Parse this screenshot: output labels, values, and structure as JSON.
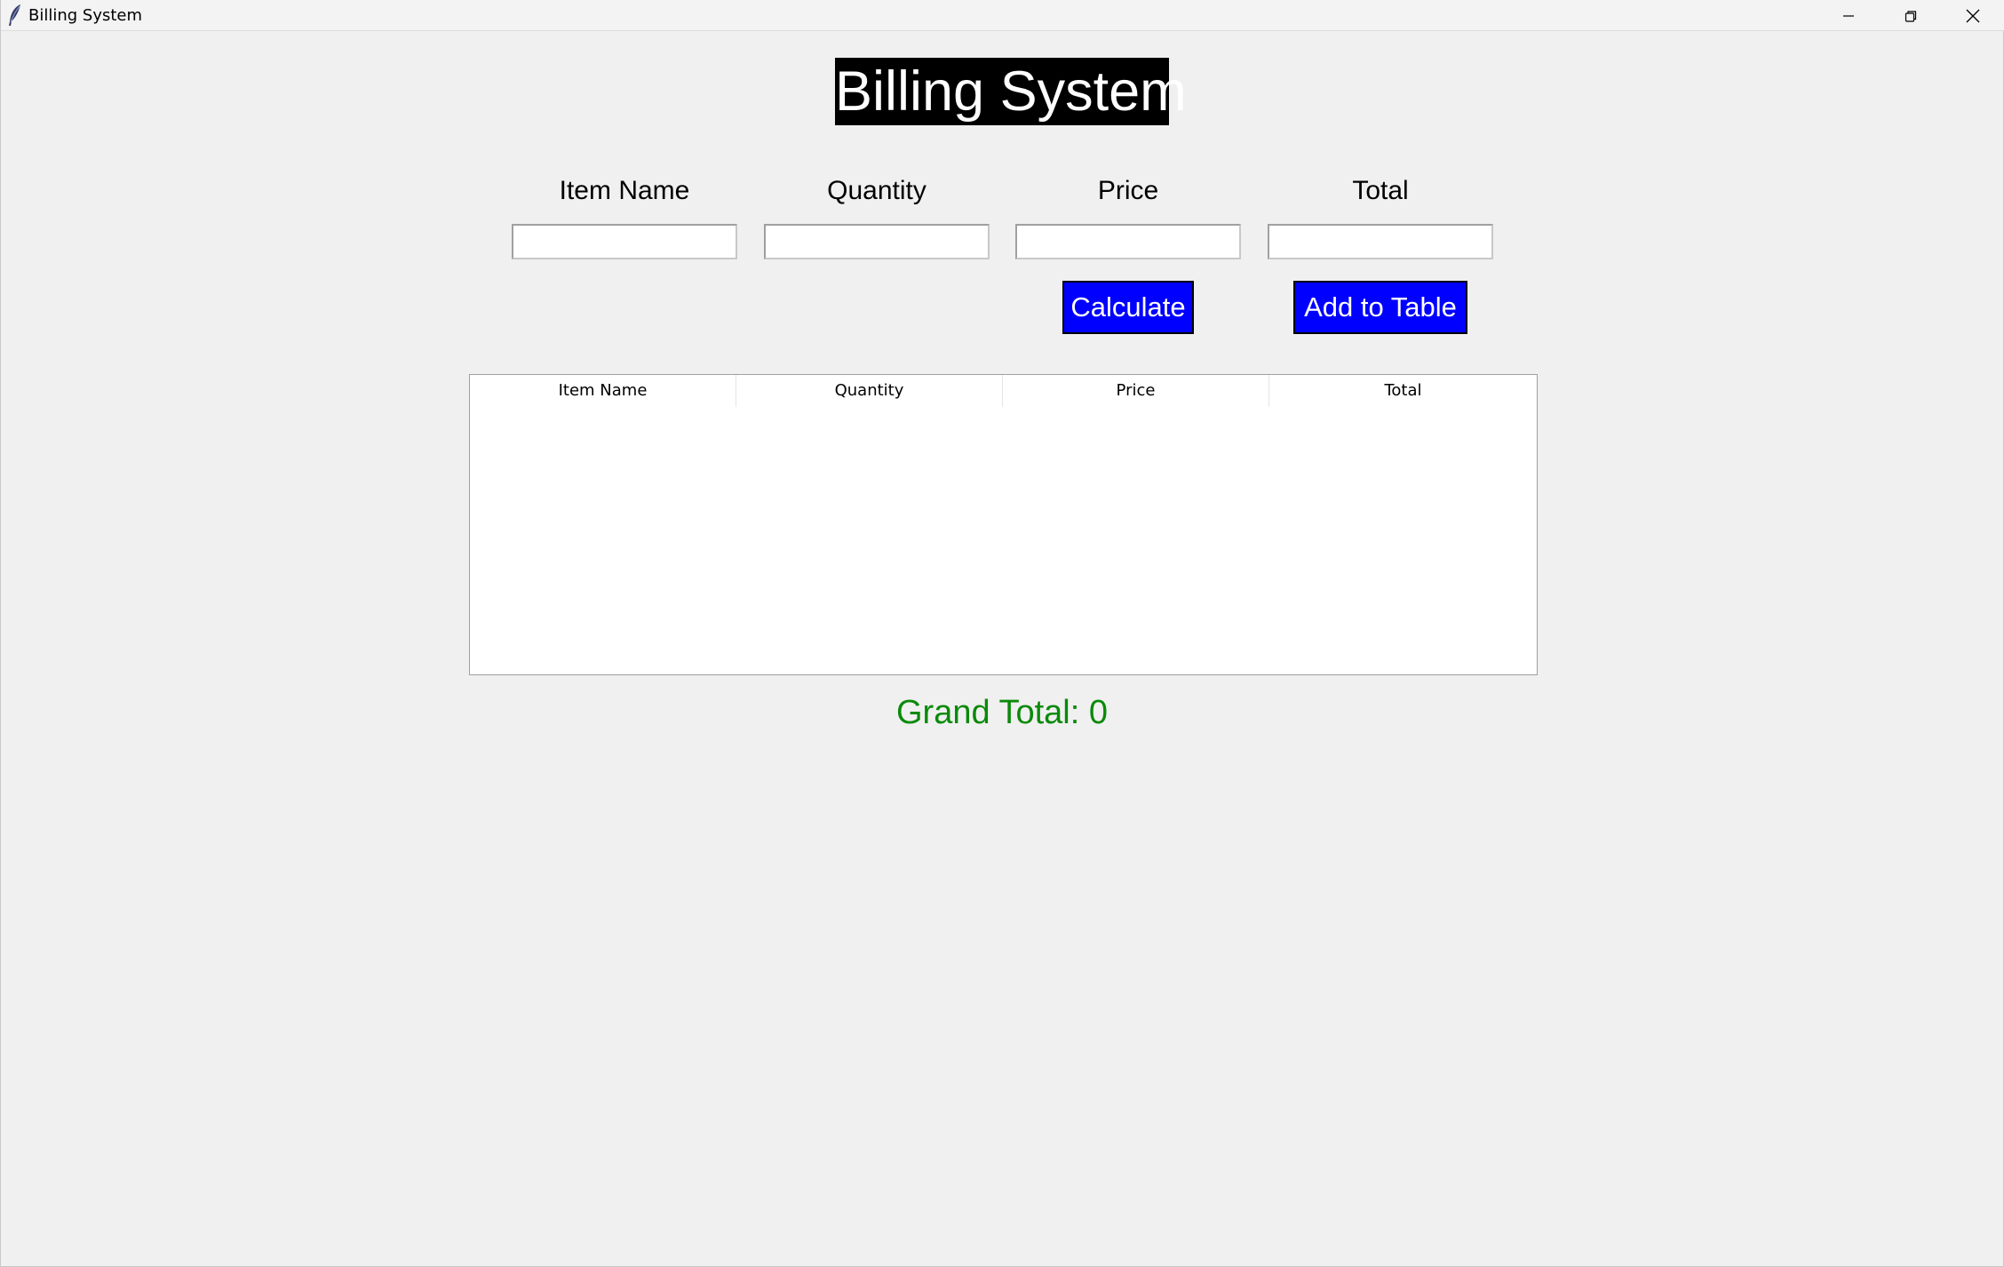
{
  "window": {
    "title": "Billing System",
    "controls": {
      "minimize": "minimize-icon",
      "maximize": "restore-icon",
      "close": "close-icon"
    }
  },
  "heading": "Billing System",
  "form": {
    "item_name_label": "Item Name",
    "quantity_label": "Quantity",
    "price_label": "Price",
    "total_label": "Total",
    "item_name_value": "",
    "quantity_value": "",
    "price_value": "",
    "total_value": ""
  },
  "buttons": {
    "calculate": "Calculate",
    "add_to_table": "Add to Table"
  },
  "table": {
    "columns": [
      "Item Name",
      "Quantity",
      "Price",
      "Total"
    ],
    "rows": []
  },
  "grand_total": "Grand Total: 0",
  "colors": {
    "button_bg": "#0000ff",
    "heading_bg": "#000000",
    "grand_total": "#0a8a0a"
  }
}
